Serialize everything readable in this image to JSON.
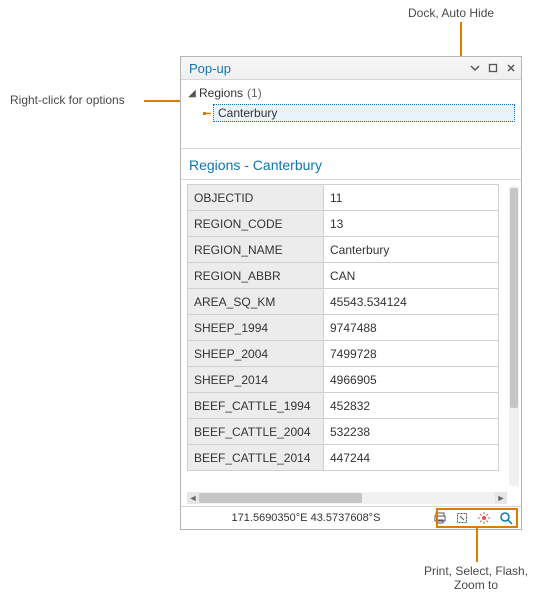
{
  "annotations": {
    "dock_label": "Dock, Auto Hide",
    "right_click_label": "Right-click for options",
    "bottom_label": "Print, Select, Flash,\nZoom to"
  },
  "popup": {
    "title": "Pop-up",
    "tree": {
      "root_label": "Regions",
      "root_count": "(1)",
      "child_label": "Canterbury"
    },
    "section_header": "Regions - Canterbury",
    "rows": [
      {
        "k": "OBJECTID",
        "v": "11"
      },
      {
        "k": "REGION_CODE",
        "v": "13"
      },
      {
        "k": "REGION_NAME",
        "v": "Canterbury"
      },
      {
        "k": "REGION_ABBR",
        "v": "CAN"
      },
      {
        "k": "AREA_SQ_KM",
        "v": "45543.534124"
      },
      {
        "k": "SHEEP_1994",
        "v": "9747488"
      },
      {
        "k": "SHEEP_2004",
        "v": "7499728"
      },
      {
        "k": "SHEEP_2014",
        "v": "4966905"
      },
      {
        "k": "BEEF_CATTLE_1994",
        "v": "452832"
      },
      {
        "k": "BEEF_CATTLE_2004",
        "v": "532238"
      },
      {
        "k": "BEEF_CATTLE_2014",
        "v": "447244"
      }
    ],
    "statusbar": {
      "coords": "171.5690350°E 43.5737608°S"
    }
  }
}
